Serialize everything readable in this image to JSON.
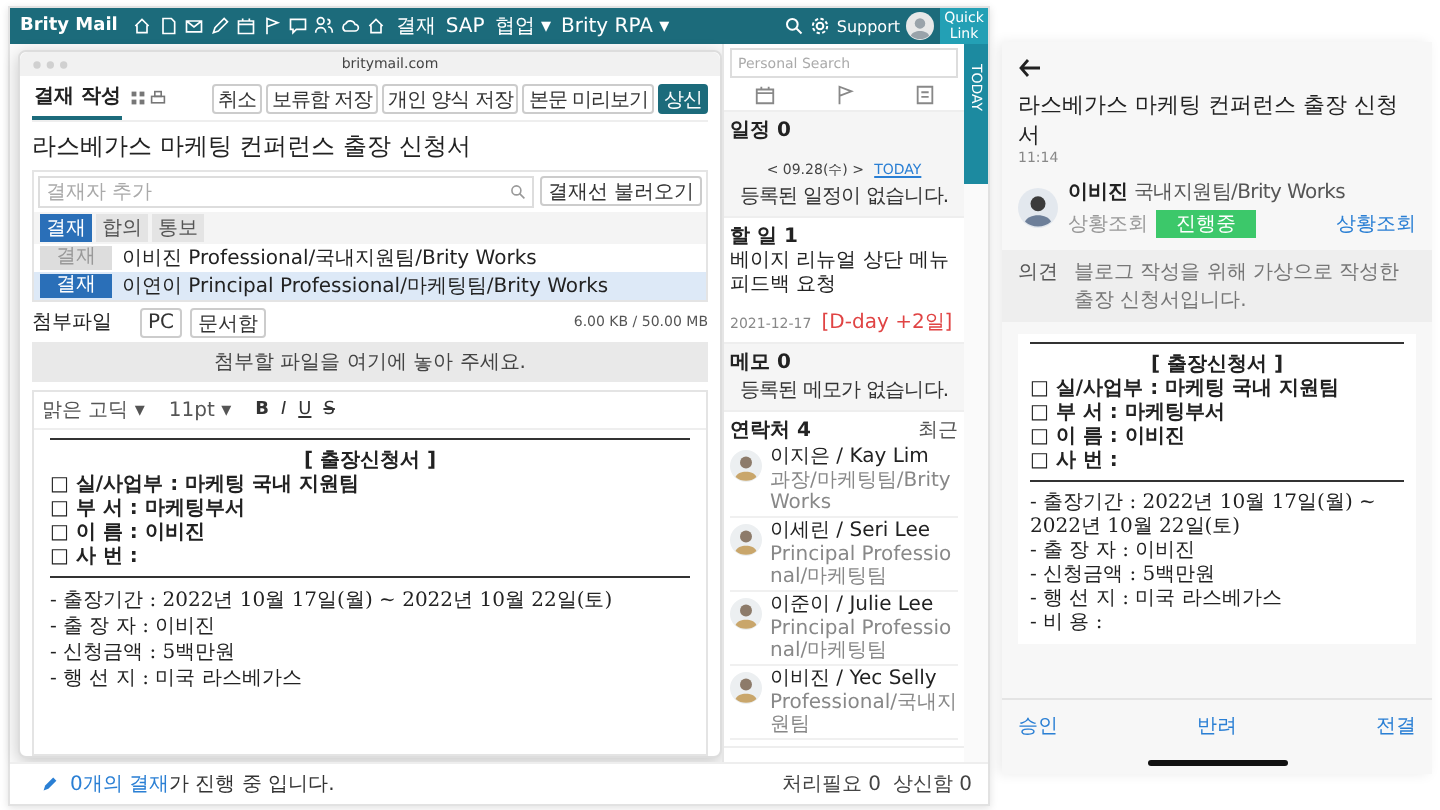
{
  "topbar": {
    "logo": "Brity Mail",
    "menus": [
      "결재",
      "SAP",
      "협업 ▾",
      "Brity RPA ▾"
    ],
    "support": "Support",
    "quick_link": "Quick Link"
  },
  "popup": {
    "url": "britymail.com",
    "tab": "결재 작성",
    "buttons": [
      {
        "label": "취소",
        "primary": false
      },
      {
        "label": "보류함 저장",
        "primary": false
      },
      {
        "label": "개인 양식 저장",
        "primary": false
      },
      {
        "label": "본문 미리보기",
        "primary": false
      },
      {
        "label": "상신",
        "primary": true
      }
    ],
    "title": "라스베가스 마케팅 컨퍼런스 출장 신청서",
    "approver_placeholder": "결재자 추가",
    "load_button": "결재선 불러오기",
    "approver_tabs": [
      {
        "label": "결재",
        "selected": true
      },
      {
        "label": "합의",
        "selected": false
      },
      {
        "label": "통보",
        "selected": false
      }
    ],
    "approvers": [
      {
        "tag": "결재",
        "name": "이비진 Professional/국내지원팀/Brity Works",
        "selected": false
      },
      {
        "tag": "결재",
        "name": "이연이 Principal Professional/마케팅팀/Brity Works",
        "selected": true
      }
    ],
    "attachments": {
      "label": "첨부파일",
      "buttons": [
        "PC",
        "문서함"
      ],
      "size": "6.00 KB / 50.00 MB",
      "drop_hint": "첨부할 파일을 여기에 놓아 주세요."
    },
    "editor": {
      "font": "맑은 고딕 ▾",
      "size": "11pt ▾",
      "format": [
        "B",
        "I",
        "U",
        "S"
      ]
    },
    "document": {
      "heading": "[ 출장신청서 ]",
      "fields": [
        "□ 실/사업부 : 마케팅 국내 지원팀",
        "□ 부 서 : 마케팅부서",
        "□ 이 름 : 이비진",
        "□ 사 번 :"
      ],
      "details": [
        "- 출장기간 : 2022년 10월 17일(월) ~ 2022년 10월 22일(토)",
        "- 출 장 자 : 이비진",
        "- 신청금액 : 5백만원",
        "- 행 선 지 : 미국 라스베가스"
      ]
    }
  },
  "side_panel": {
    "search_placeholder": "Personal Search",
    "schedule": {
      "title": "일정 0",
      "date": "< 09.28(수) >",
      "today": "TODAY",
      "empty": "등록된 일정이 없습니다."
    },
    "todo": {
      "title": "할 일 1",
      "item": "베이지 리뉴얼 상단 메뉴 피드백 요청",
      "date": "2021-12-17",
      "due": "[D-day +2일]"
    },
    "memo": {
      "title": "메모 0",
      "empty": "등록된 메모가 없습니다."
    },
    "contacts": {
      "title": "연락처 4",
      "recent": "최근",
      "items": [
        {
          "name": "이지은 / Kay Lim",
          "detail": "과장/마케팅팀/Brity Works"
        },
        {
          "name": "이세린 / Seri Lee",
          "detail": "Principal Professional/마케팅팀"
        },
        {
          "name": "이준이 / Julie Lee",
          "detail": "Principal Professional/마케팅팀"
        },
        {
          "name": "이비진 / Yec Selly",
          "detail": "Professional/국내지원팀"
        }
      ]
    },
    "today_tab": "TODAY"
  },
  "status_bar": {
    "highlight": "0개의 결재",
    "text": "가 진행 중 입니다.",
    "counters": [
      "처리필요 0",
      "상신함 0"
    ]
  },
  "mobile": {
    "title": "라스베가스 마케팅 컨퍼런스 출장 신청서",
    "time": "11:14",
    "author": "이비진",
    "team": "국내지원팀/Brity Works",
    "status_label": "상황조회",
    "status": "진행중",
    "status_link": "상황조회",
    "opinion_label": "의견",
    "opinion": "블로그 작성을 위해 가상으로 작성한 출장 신청서입니다.",
    "document": {
      "heading": "[ 출장신청서 ]",
      "fields": [
        "□ 실/사업부 : 마케팅 국내 지원팀",
        "□ 부 서 : 마케팅부서",
        "□ 이 름 : 이비진",
        "□ 사 번 :"
      ],
      "details": [
        "- 출장기간 : 2022년 10월 17일(월) ~ 2022년 10월 22일(토)",
        "- 출 장 자 : 이비진",
        "- 신청금액 : 5백만원",
        "- 행 선 지 : 미국 라스베가스",
        "- 비 용 :"
      ]
    },
    "actions": [
      "승인",
      "반려",
      "전결"
    ]
  }
}
